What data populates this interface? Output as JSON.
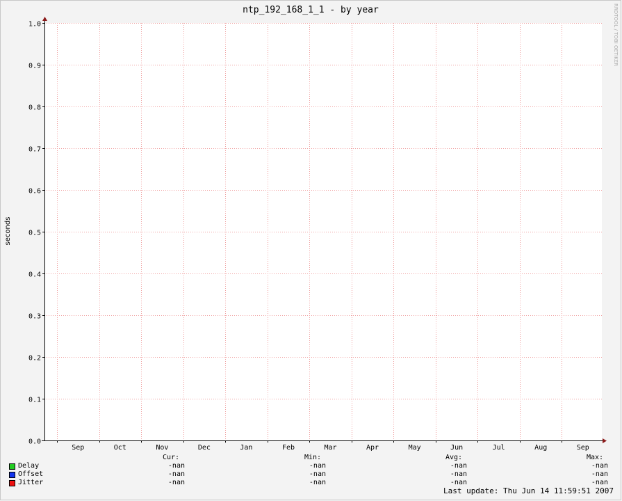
{
  "watermark": "RRDTOOL / TOBI OETIKER",
  "legend_headers": [
    "Cur:",
    "Min:",
    "Avg:",
    "Max:"
  ],
  "legend": [
    {
      "name": "Delay",
      "color": "#22cc22",
      "cur": "-nan",
      "min": "-nan",
      "avg": "-nan",
      "max": "-nan"
    },
    {
      "name": "Offset",
      "color": "#1133ee",
      "cur": "-nan",
      "min": "-nan",
      "avg": "-nan",
      "max": "-nan"
    },
    {
      "name": "Jitter",
      "color": "#ee1111",
      "cur": "-nan",
      "min": "-nan",
      "avg": "-nan",
      "max": "-nan"
    }
  ],
  "last_update": "Last update: Thu Jun 14 11:59:51 2007",
  "chart_data": {
    "type": "line",
    "title": "ntp_192_168_1_1 - by year",
    "xlabel": "",
    "ylabel": "seconds",
    "ylim": [
      0,
      1.0
    ],
    "y_ticks": [
      "0.0",
      "0.1",
      "0.2",
      "0.3",
      "0.4",
      "0.5",
      "0.6",
      "0.7",
      "0.8",
      "0.9",
      "1.0"
    ],
    "x_tick_labels": [
      "Sep",
      "Oct",
      "Nov",
      "Dec",
      "Jan",
      "Feb",
      "Mar",
      "Apr",
      "May",
      "Jun",
      "Jul",
      "Aug",
      "Sep"
    ],
    "grid": true,
    "series": [
      {
        "name": "Delay",
        "values": []
      },
      {
        "name": "Offset",
        "values": []
      },
      {
        "name": "Jitter",
        "values": []
      }
    ]
  }
}
